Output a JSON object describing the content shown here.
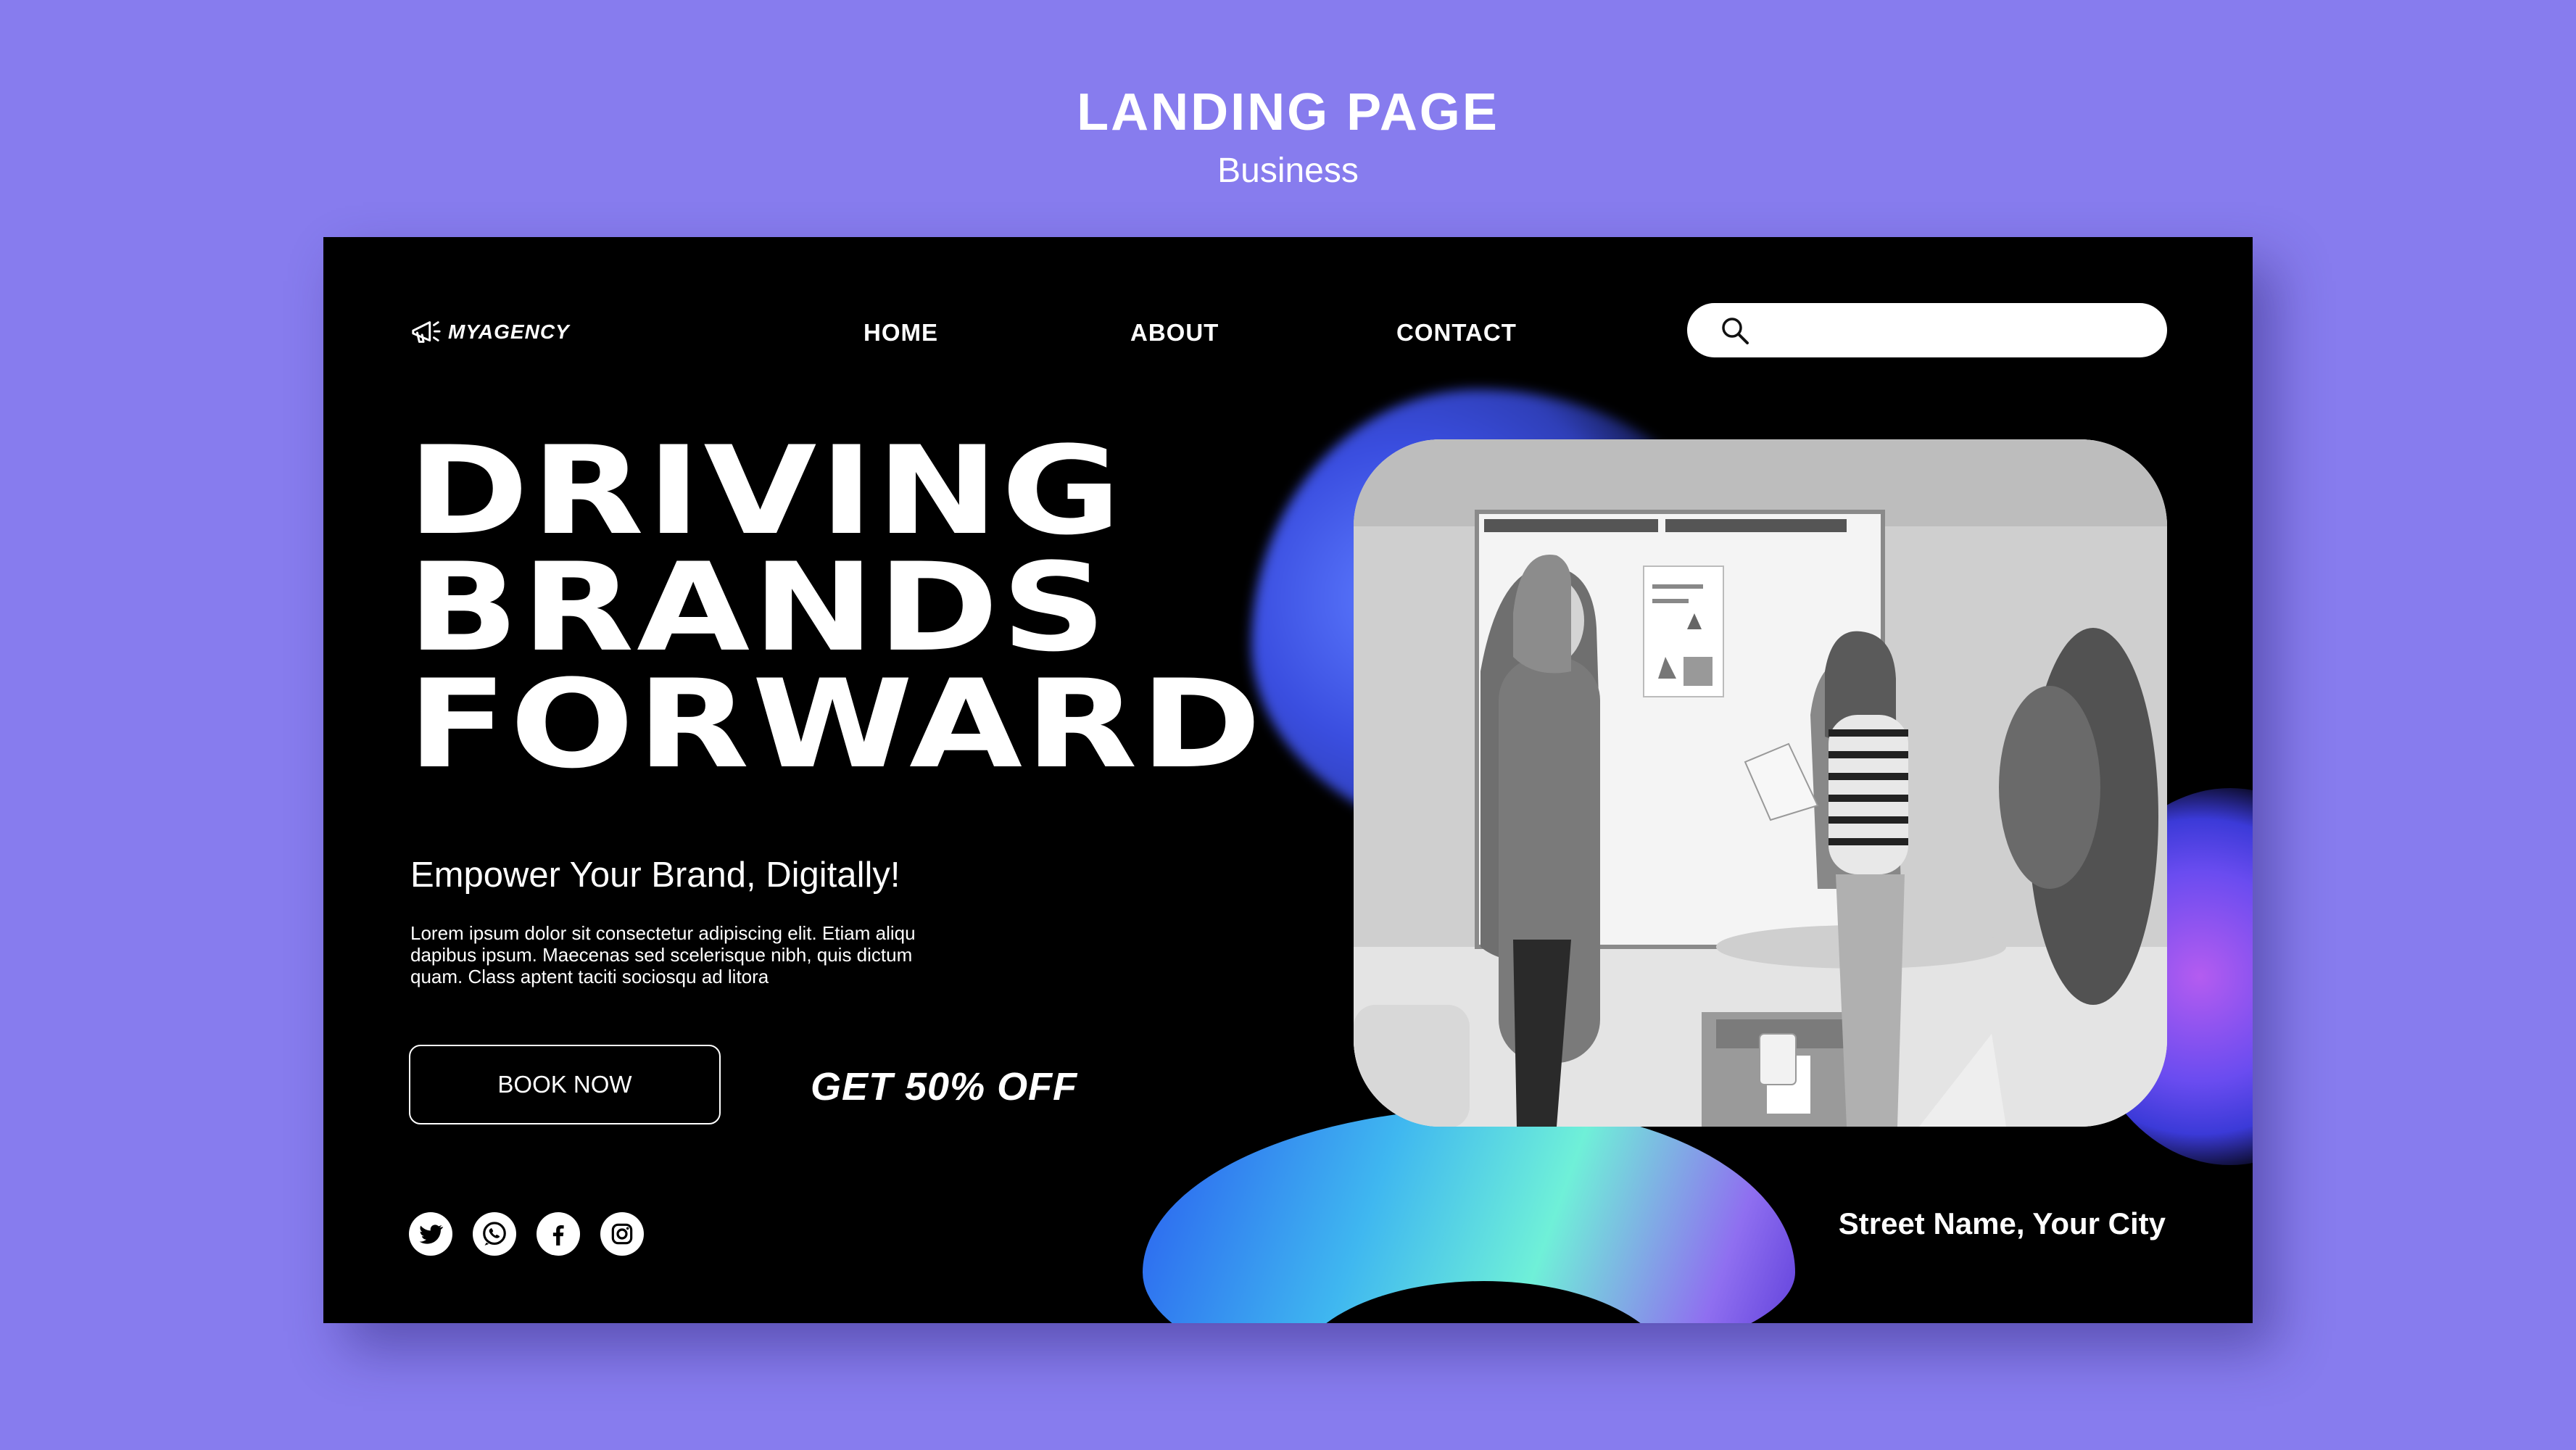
{
  "header": {
    "title": "LANDING PAGE",
    "subtitle": "Business"
  },
  "brand": {
    "name": "MYAGENCY",
    "logo_icon": "megaphone-icon"
  },
  "nav": {
    "items": [
      {
        "label": "HOME"
      },
      {
        "label": "ABOUT"
      },
      {
        "label": "CONTACT"
      }
    ]
  },
  "search": {
    "icon": "search-icon",
    "value": "",
    "placeholder": ""
  },
  "hero": {
    "lines": [
      "DRIVING",
      "BRANDS",
      "FORWARD"
    ],
    "tagline": "Empower Your Brand, Digitally!",
    "body": "Lorem ipsum dolor sit consectetur adipiscing elit. Etiam aliqu dapibus ipsum. Maecenas sed scelerisque nibh, quis dictum quam. Class aptent taciti sociosqu ad litora",
    "cta_label": "BOOK NOW",
    "promo": "GET 50% OFF"
  },
  "social": [
    "twitter-icon",
    "whatsapp-icon",
    "facebook-icon",
    "instagram-icon"
  ],
  "address": "Street Name, Your City",
  "colors": {
    "background": "#877cee",
    "panel": "#000000",
    "text": "#ffffff",
    "blob_blue": "#3a4ee0",
    "blob_teal": "#6ff0d8",
    "blob_purple": "#b45cf0"
  }
}
